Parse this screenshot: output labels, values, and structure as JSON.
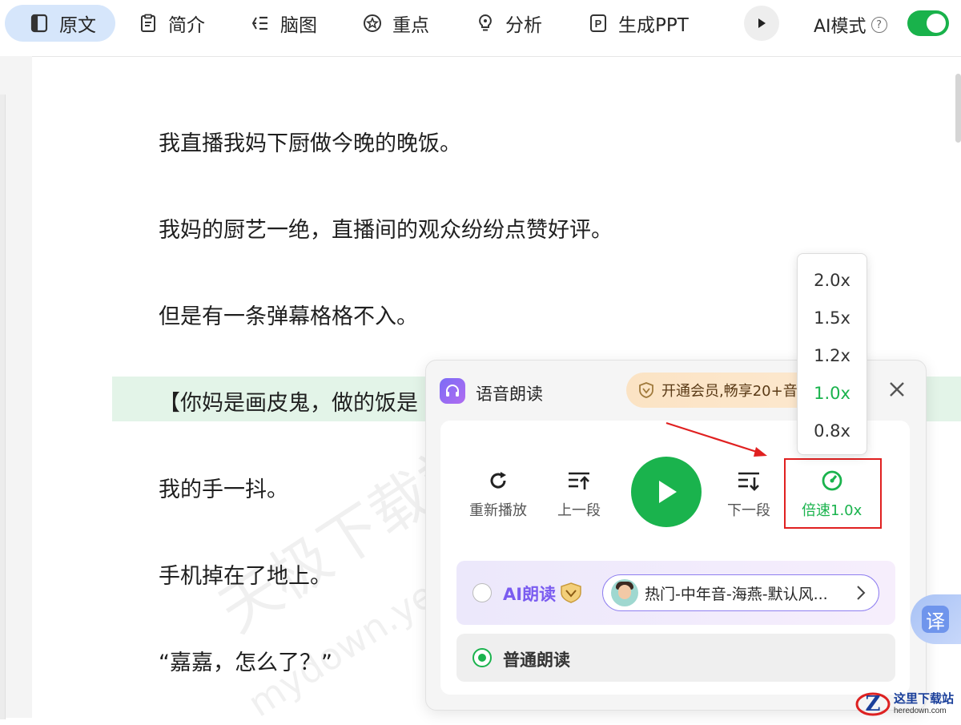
{
  "tabs": [
    {
      "label": "原文",
      "icon": "document-icon"
    },
    {
      "label": "简介",
      "icon": "clipboard-icon"
    },
    {
      "label": "脑图",
      "icon": "mindmap-icon"
    },
    {
      "label": "重点",
      "icon": "star-icon"
    },
    {
      "label": "分析",
      "icon": "lightbulb-icon"
    },
    {
      "label": "生成PPT",
      "icon": "ppt-icon"
    }
  ],
  "header": {
    "ai_mode_label": "AI模式",
    "help_symbol": "?",
    "ai_mode_enabled": true
  },
  "document": {
    "paragraphs": [
      "我直播我妈下厨做今晚的晚饭。",
      "我妈的厨艺一绝，直播间的观众纷纷点赞好评。",
      "但是有一条弹幕格格不入。",
      "【你妈是画皮鬼，做的饭是",
      "我的手一抖。",
      "手机掉在了地上。",
      "“嘉嘉，怎么了？”"
    ],
    "watermark": "天极下载站",
    "watermark_url": "mydown.yesky.com"
  },
  "voice_panel": {
    "title": "语音朗读",
    "vip_banner": "开通会员,畅享20+音",
    "controls": {
      "replay": "重新播放",
      "prev": "上一段",
      "next": "下一段",
      "speed": "倍速1.0x"
    },
    "ai_read": {
      "label": "AI朗读",
      "voice": "热门-中年音-海燕-默认风...",
      "selected": false
    },
    "normal_read": {
      "label": "普通朗读",
      "selected": true
    }
  },
  "speed_menu": {
    "options": [
      "2.0x",
      "1.5x",
      "1.2x",
      "1.0x",
      "0.8x"
    ],
    "selected": "1.0x"
  },
  "translate_button": {
    "label": "译"
  },
  "site_logo": {
    "name": "这里下载站",
    "url": "heredown.com"
  },
  "colors": {
    "accent_green": "#1ab34d",
    "active_tab_bg": "#d6e6fb",
    "highlight_bg": "#e3f4e8",
    "annotation_red": "#e02020"
  }
}
